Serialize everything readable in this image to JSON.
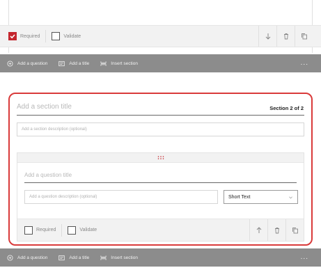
{
  "top_question": {
    "required_label": "Required",
    "required_checked": true,
    "validate_label": "Validate",
    "validate_checked": false
  },
  "toolbar": {
    "add_question": "Add a question",
    "add_title": "Add a title",
    "insert_section": "Insert section",
    "more": "..."
  },
  "section": {
    "title_placeholder": "Add a section title",
    "count": "Section 2 of 2",
    "description_placeholder": "Add a section description (optional)",
    "question": {
      "title_placeholder": "Add a question title",
      "description_placeholder": "Add a question description (optional)",
      "type_selected": "Short Text",
      "required_label": "Required",
      "required_checked": false,
      "validate_label": "Validate",
      "validate_checked": false
    }
  },
  "colors": {
    "accent": "#c4262e",
    "section_border": "#d93a3a",
    "toolbar_bg": "#8c8c8c"
  },
  "icons": {
    "check": "check-icon",
    "down": "arrow-down-icon",
    "up": "arrow-up-icon",
    "delete": "trash-icon",
    "copy": "copy-icon",
    "add": "plus-circle-icon",
    "title": "title-icon",
    "insert_section": "insert-section-icon",
    "drag": "drag-handle-icon",
    "dropdown": "chevron-down-icon"
  }
}
